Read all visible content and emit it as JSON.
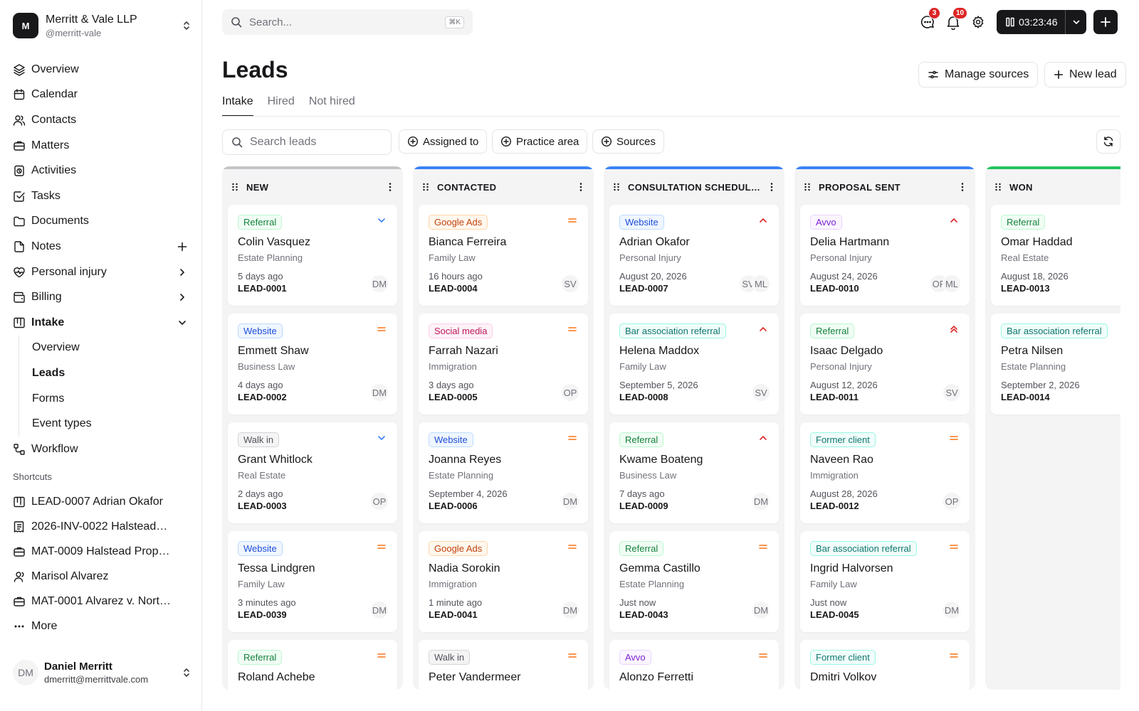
{
  "org": {
    "initial": "M",
    "name": "Merritt & Vale LLP",
    "handle": "@merritt-vale"
  },
  "nav": [
    {
      "label": "Overview",
      "icon": "layers-icon"
    },
    {
      "label": "Calendar",
      "icon": "calendar-icon"
    },
    {
      "label": "Contacts",
      "icon": "users-icon"
    },
    {
      "label": "Matters",
      "icon": "briefcase-icon"
    },
    {
      "label": "Activities",
      "icon": "activity-icon"
    },
    {
      "label": "Tasks",
      "icon": "check-square-icon"
    },
    {
      "label": "Documents",
      "icon": "folder-icon"
    },
    {
      "label": "Notes",
      "icon": "file-icon"
    },
    {
      "label": "Personal injury",
      "icon": "heart-icon"
    },
    {
      "label": "Billing",
      "icon": "wallet-icon"
    },
    {
      "label": "Intake",
      "icon": "kanban-icon"
    },
    {
      "label": "Workflow",
      "icon": "workflow-icon"
    }
  ],
  "intake_sub": [
    "Overview",
    "Leads",
    "Forms",
    "Event types"
  ],
  "shortcuts_title": "Shortcuts",
  "shortcuts": [
    {
      "label": "LEAD-0007 Adrian Okafor",
      "icon": "kanban-icon"
    },
    {
      "label": "2026-INV-0022 Halstead…",
      "icon": "invoice-icon"
    },
    {
      "label": "MAT-0009 Halstead Prop…",
      "icon": "briefcase-icon"
    },
    {
      "label": "Marisol Alvarez",
      "icon": "user-icon"
    },
    {
      "label": "MAT-0001 Alvarez v. Nort…",
      "icon": "briefcase-icon"
    },
    {
      "label": "More",
      "icon": "more-icon"
    }
  ],
  "user": {
    "initials": "DM",
    "name": "Daniel Merritt",
    "email": "dmerritt@merrittvale.com"
  },
  "topbar": {
    "search_placeholder": "Search...",
    "shortcut": "⌘K",
    "messages_count": "3",
    "notifications_count": "10",
    "timer": "03:23:46"
  },
  "page": {
    "title": "Leads",
    "manage_sources": "Manage sources",
    "new_lead": "New lead"
  },
  "tabs": [
    "Intake",
    "Hired",
    "Not hired"
  ],
  "filters": {
    "search_placeholder": "Search leads",
    "assigned": "Assigned to",
    "practice": "Practice area",
    "sources": "Sources"
  },
  "colors": {
    "accent_blue": "#3b82f6",
    "won_green": "#22c55e",
    "new_gray": "#c4c4c8",
    "high_priority": "#dc2626",
    "medium_priority": "#f97316",
    "low_priority": "#3b82f6"
  },
  "columns": [
    {
      "title": "NEW",
      "top_color": "#c4c4c8",
      "cards": [
        {
          "source": "Referral",
          "tag": "green",
          "priority": "low",
          "name": "Colin Vasquez",
          "area": "Estate Planning",
          "when": "5 days ago",
          "id": "LEAD-0001",
          "avatars": [
            "DM"
          ]
        },
        {
          "source": "Website",
          "tag": "blue",
          "priority": "medium",
          "name": "Emmett Shaw",
          "area": "Business Law",
          "when": "4 days ago",
          "id": "LEAD-0002",
          "avatars": [
            "DM"
          ]
        },
        {
          "source": "Walk in",
          "tag": "gray",
          "priority": "low",
          "name": "Grant Whitlock",
          "area": "Real Estate",
          "when": "2 days ago",
          "id": "LEAD-0003",
          "avatars": [
            "OP"
          ]
        },
        {
          "source": "Website",
          "tag": "blue",
          "priority": "medium",
          "name": "Tessa Lindgren",
          "area": "Family Law",
          "when": "3 minutes ago",
          "id": "LEAD-0039",
          "avatars": [
            "DM"
          ]
        },
        {
          "source": "Referral",
          "tag": "green",
          "priority": "medium",
          "name": "Roland Achebe",
          "area": "",
          "when": "",
          "id": "",
          "avatars": []
        }
      ]
    },
    {
      "title": "CONTACTED",
      "top_color": "#3b82f6",
      "cards": [
        {
          "source": "Google Ads",
          "tag": "orange",
          "priority": "medium",
          "name": "Bianca Ferreira",
          "area": "Family Law",
          "when": "16 hours ago",
          "id": "LEAD-0004",
          "avatars": [
            "SV"
          ]
        },
        {
          "source": "Social media",
          "tag": "pink",
          "priority": "medium",
          "name": "Farrah Nazari",
          "area": "Immigration",
          "when": "3 days ago",
          "id": "LEAD-0005",
          "avatars": [
            "OP"
          ]
        },
        {
          "source": "Website",
          "tag": "blue",
          "priority": "medium",
          "name": "Joanna Reyes",
          "area": "Estate Planning",
          "when": "September 4, 2026",
          "id": "LEAD-0006",
          "avatars": [
            "DM"
          ]
        },
        {
          "source": "Google Ads",
          "tag": "orange",
          "priority": "medium",
          "name": "Nadia Sorokin",
          "area": "Immigration",
          "when": "1 minute ago",
          "id": "LEAD-0041",
          "avatars": [
            "DM"
          ]
        },
        {
          "source": "Walk in",
          "tag": "gray",
          "priority": "medium",
          "name": "Peter Vandermeer",
          "area": "",
          "when": "",
          "id": "",
          "avatars": []
        }
      ]
    },
    {
      "title": "CONSULTATION SCHEDULE…",
      "top_color": "#3b82f6",
      "cards": [
        {
          "source": "Website",
          "tag": "blue",
          "priority": "high",
          "name": "Adrian Okafor",
          "area": "Personal Injury",
          "when": "August 20, 2026",
          "id": "LEAD-0007",
          "avatars": [
            "SV",
            "ML"
          ]
        },
        {
          "source": "Bar association referral",
          "tag": "teal",
          "priority": "high",
          "name": "Helena Maddox",
          "area": "Family Law",
          "when": "September 5, 2026",
          "id": "LEAD-0008",
          "avatars": [
            "SV"
          ]
        },
        {
          "source": "Referral",
          "tag": "green",
          "priority": "high",
          "name": "Kwame Boateng",
          "area": "Business Law",
          "when": "7 days ago",
          "id": "LEAD-0009",
          "avatars": [
            "DM"
          ]
        },
        {
          "source": "Referral",
          "tag": "green",
          "priority": "medium",
          "name": "Gemma Castillo",
          "area": "Estate Planning",
          "when": "Just now",
          "id": "LEAD-0043",
          "avatars": [
            "DM"
          ]
        },
        {
          "source": "Avvo",
          "tag": "purple",
          "priority": "medium",
          "name": "Alonzo Ferretti",
          "area": "",
          "when": "",
          "id": "",
          "avatars": []
        }
      ]
    },
    {
      "title": "PROPOSAL SENT",
      "top_color": "#3b82f6",
      "cards": [
        {
          "source": "Avvo",
          "tag": "purple",
          "priority": "high",
          "name": "Delia Hartmann",
          "area": "Personal Injury",
          "when": "August 24, 2026",
          "id": "LEAD-0010",
          "avatars": [
            "OP",
            "ML"
          ]
        },
        {
          "source": "Referral",
          "tag": "green",
          "priority": "urgent",
          "name": "Isaac Delgado",
          "area": "Personal Injury",
          "when": "August 12, 2026",
          "id": "LEAD-0011",
          "avatars": [
            "SV"
          ]
        },
        {
          "source": "Former client",
          "tag": "teal",
          "priority": "medium",
          "name": "Naveen Rao",
          "area": "Immigration",
          "when": "August 28, 2026",
          "id": "LEAD-0012",
          "avatars": [
            "OP"
          ]
        },
        {
          "source": "Bar association referral",
          "tag": "teal",
          "priority": "medium",
          "name": "Ingrid Halvorsen",
          "area": "Family Law",
          "when": "Just now",
          "id": "LEAD-0045",
          "avatars": [
            "DM"
          ]
        },
        {
          "source": "Former client",
          "tag": "teal",
          "priority": "medium",
          "name": "Dmitri Volkov",
          "area": "",
          "when": "",
          "id": "",
          "avatars": []
        }
      ]
    },
    {
      "title": "WON",
      "top_color": "#22c55e",
      "cards": [
        {
          "source": "Referral",
          "tag": "green",
          "priority": "",
          "name": "Omar Haddad",
          "area": "Real Estate",
          "when": "August 18, 2026",
          "id": "LEAD-0013",
          "avatars": []
        },
        {
          "source": "Bar association referral",
          "tag": "teal",
          "priority": "",
          "name": "Petra Nilsen",
          "area": "Estate Planning",
          "when": "September 2, 2026",
          "id": "LEAD-0014",
          "avatars": []
        }
      ]
    }
  ]
}
